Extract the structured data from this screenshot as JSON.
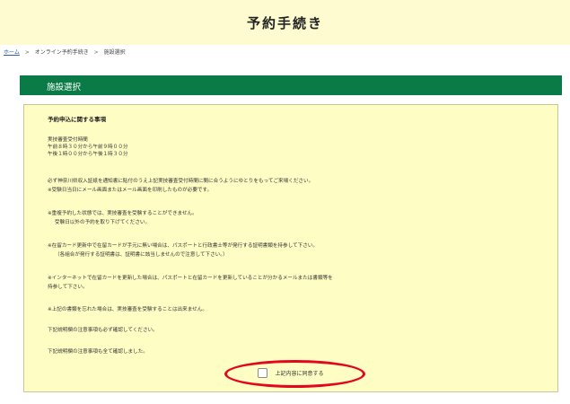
{
  "header": {
    "title": "予約手続き"
  },
  "breadcrumb": {
    "home": "ホーム",
    "step1": "オンライン予約手続き",
    "step2": "施設選択"
  },
  "section": {
    "title": "施設選択"
  },
  "notice": {
    "heading": "予約申込に関する事項",
    "lines": [
      "実技審査受付時間",
      "午前８時３０分から午前９時００分",
      "午後１時００分から午後１時３０分",
      "必ず神奈川県収入証紙を通知書に貼付のうえ上記実技審査受付時間に間に合うようにゆとりをもってご来場ください。",
      "※受験日当日にメール画面またはメール画面を印刷したものが必要です。",
      "※重複予約した状態では、実技審査を受験することができません。",
      "受験日以外の予約を取り下げてください。",
      "※在留カード更新中で在留カードが手元に無い場合は、パスポートと行政書士等が発行する証明書類を持参して下さい。",
      "（各組合が発行する証明書は、証明書に該当しませんので注意して下さい。）",
      "※インターネットで在留カードを更新した場合は、パスポートと在留カードを更新していることが分かるメールまたは書類等を",
      "持参して下さい。",
      "※上記の書類を忘れた場合は、実技審査を受験することは出来ません。",
      "下記説明欄の注意事項も必ず確認してください。",
      "下記説明欄の注意事項も全て確認しました。"
    ]
  },
  "agree": {
    "label": "上記内容に同意する",
    "checked": false
  },
  "colors": {
    "header_bg": "#fdfbcf",
    "section_bar": "#0a7a46",
    "panel_bg": "#fefdc4",
    "annotation": "#e3061f"
  }
}
